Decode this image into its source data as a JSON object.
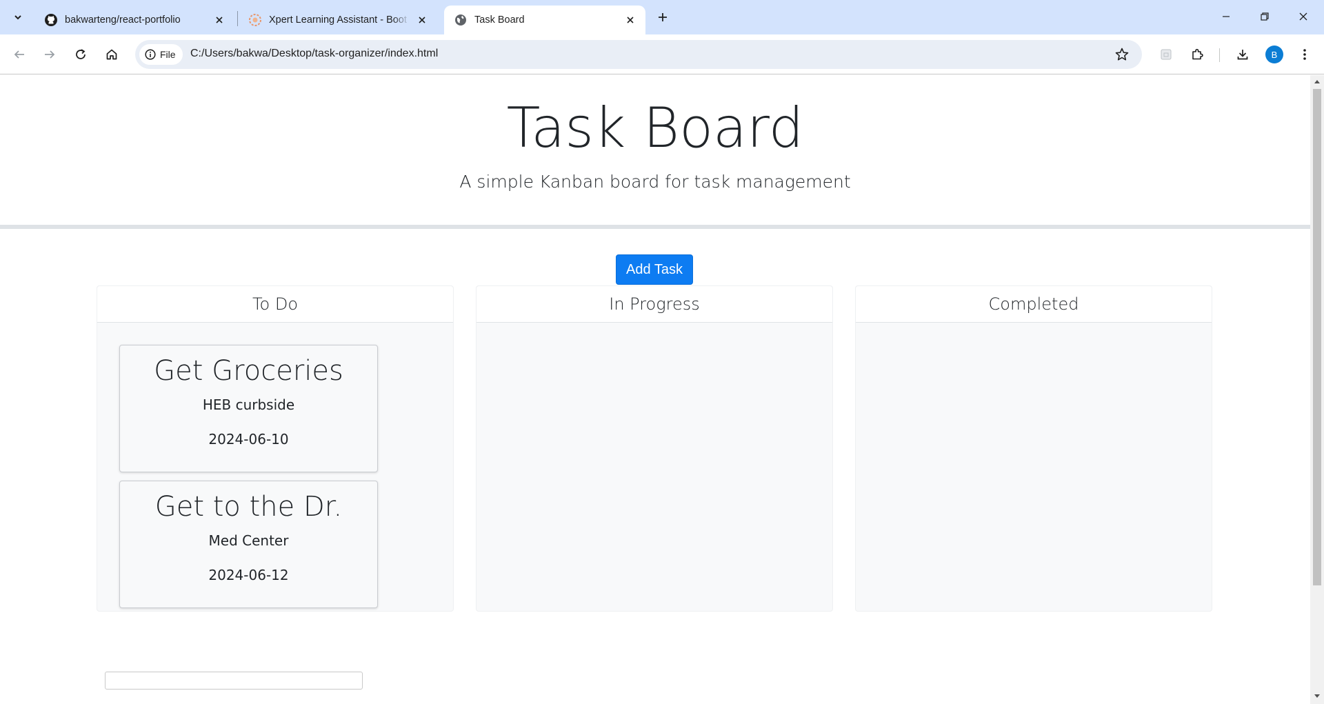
{
  "browser": {
    "tabs": [
      {
        "title": "bakwarteng/react-portfolio",
        "icon": "github-icon",
        "active": false
      },
      {
        "title": "Xpert Learning Assistant - Boot",
        "icon": "xpert-icon",
        "active": false
      },
      {
        "title": "Task Board",
        "icon": "globe-icon",
        "active": true
      }
    ],
    "address": {
      "chip_label": "File",
      "url": "C:/Users/bakwa/Desktop/task-organizer/index.html"
    },
    "profile_initial": "B",
    "accent_color": "#d3e3fd"
  },
  "page": {
    "title": "Task Board",
    "subtitle": "A simple Kanban board for task management",
    "add_task_label": "Add Task",
    "button_color": "#0d7cf2",
    "lanes": [
      {
        "name": "To Do",
        "cards": [
          {
            "title": "Get Groceries",
            "description": "HEB curbside",
            "date": "2024-06-10"
          },
          {
            "title": "Get to the Dr.",
            "description": "Med Center",
            "date": "2024-06-12"
          }
        ]
      },
      {
        "name": "In Progress",
        "cards": []
      },
      {
        "name": "Completed",
        "cards": []
      }
    ],
    "footer_input_value": ""
  }
}
